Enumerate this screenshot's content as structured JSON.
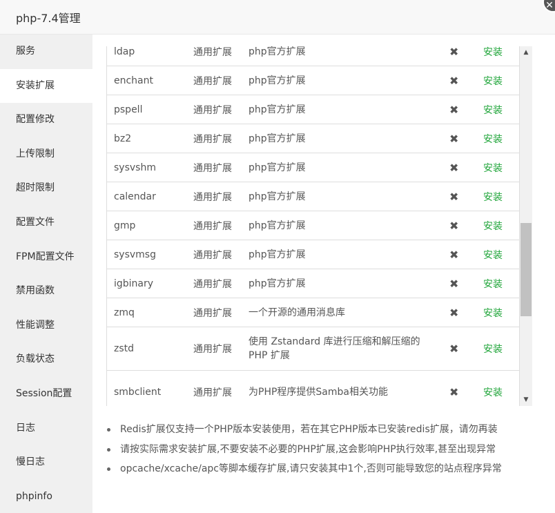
{
  "window": {
    "title": "php-7.4管理"
  },
  "sidebar": {
    "items": [
      {
        "label": "服务",
        "active": false
      },
      {
        "label": "安装扩展",
        "active": true
      },
      {
        "label": "配置修改",
        "active": false
      },
      {
        "label": "上传限制",
        "active": false
      },
      {
        "label": "超时限制",
        "active": false
      },
      {
        "label": "配置文件",
        "active": false
      },
      {
        "label": "FPM配置文件",
        "active": false
      },
      {
        "label": "禁用函数",
        "active": false
      },
      {
        "label": "性能调整",
        "active": false
      },
      {
        "label": "负载状态",
        "active": false
      },
      {
        "label": "Session配置",
        "active": false
      },
      {
        "label": "日志",
        "active": false
      },
      {
        "label": "慢日志",
        "active": false
      },
      {
        "label": "phpinfo",
        "active": false
      }
    ]
  },
  "extensions": {
    "rows": [
      {
        "name": "ldap",
        "type": "通用扩展",
        "desc": "php官方扩展",
        "status_icon": "cross-icon",
        "action": "安装"
      },
      {
        "name": "enchant",
        "type": "通用扩展",
        "desc": "php官方扩展",
        "status_icon": "cross-icon",
        "action": "安装"
      },
      {
        "name": "pspell",
        "type": "通用扩展",
        "desc": "php官方扩展",
        "status_icon": "cross-icon",
        "action": "安装"
      },
      {
        "name": "bz2",
        "type": "通用扩展",
        "desc": "php官方扩展",
        "status_icon": "cross-icon",
        "action": "安装"
      },
      {
        "name": "sysvshm",
        "type": "通用扩展",
        "desc": "php官方扩展",
        "status_icon": "cross-icon",
        "action": "安装"
      },
      {
        "name": "calendar",
        "type": "通用扩展",
        "desc": "php官方扩展",
        "status_icon": "cross-icon",
        "action": "安装"
      },
      {
        "name": "gmp",
        "type": "通用扩展",
        "desc": "php官方扩展",
        "status_icon": "cross-icon",
        "action": "安装"
      },
      {
        "name": "sysvmsg",
        "type": "通用扩展",
        "desc": "php官方扩展",
        "status_icon": "cross-icon",
        "action": "安装"
      },
      {
        "name": "igbinary",
        "type": "通用扩展",
        "desc": "php官方扩展",
        "status_icon": "cross-icon",
        "action": "安装"
      },
      {
        "name": "zmq",
        "type": "通用扩展",
        "desc": "一个开源的通用消息库",
        "status_icon": "cross-icon",
        "action": "安装"
      },
      {
        "name": "zstd",
        "type": "通用扩展",
        "desc": "使用 Zstandard 库进行压缩和解压缩的PHP 扩展",
        "status_icon": "cross-icon",
        "action": "安装"
      },
      {
        "name": "smbclient",
        "type": "通用扩展",
        "desc": "为PHP程序提供Samba相关功能",
        "status_icon": "cross-icon",
        "action": "安装"
      }
    ],
    "scroll_position": 0.68
  },
  "notes": [
    "Redis扩展仅支持一个PHP版本安装使用，若在其它PHP版本已安装redis扩展，请勿再装",
    "请按实际需求安装扩展,不要安装不必要的PHP扩展,这会影响PHP执行效率,甚至出现异常",
    "opcache/xcache/apc等脚本缓存扩展,请只安装其中1个,否则可能导致您的站点程序异常"
  ],
  "colors": {
    "action_green": "#20a53a",
    "sidebar_bg": "#f0f0f0"
  }
}
